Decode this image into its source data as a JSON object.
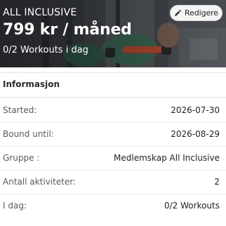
{
  "plan": {
    "name": "ALL INCLUSIVE",
    "price": "799 kr / måned",
    "workouts_today": "0/2 Workouts i dag",
    "edit_label": "Redigere",
    "edit_icon": "pencil-icon"
  },
  "info": {
    "title": "Informasjon",
    "rows": [
      {
        "label": "Started:",
        "value": "2026-07-30"
      },
      {
        "label": "Bound until:",
        "value": "2026-08-29"
      },
      {
        "label": "Gruppe :",
        "value": "Medlemskap All Inclusive"
      },
      {
        "label": "Antall aktiviteter:",
        "value": "2"
      },
      {
        "label": "I dag:",
        "value": "0/2 Workouts"
      }
    ]
  },
  "colors": {
    "hero_overlay": "#3a3e42",
    "text_primary": "#1f1f1f",
    "text_label": "#5a5a5a",
    "divider": "#ededed",
    "edit_button_bg": "#f4f4f4"
  }
}
